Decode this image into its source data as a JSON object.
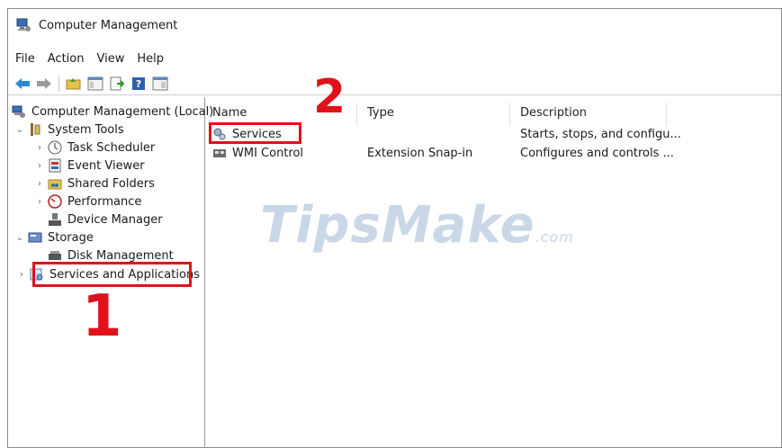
{
  "window": {
    "title": "Computer Management"
  },
  "menu": [
    "File",
    "Action",
    "View",
    "Help"
  ],
  "toolbar": {
    "icons": [
      "back-arrow-icon",
      "forward-arrow-icon",
      "up-folder-icon",
      "console-tree-icon",
      "export-list-icon",
      "help-icon",
      "show-hide-icon"
    ]
  },
  "tree": {
    "root": "Computer Management (Local)",
    "system_tools": "System Tools",
    "task_scheduler": "Task Scheduler",
    "event_viewer": "Event Viewer",
    "shared_folders": "Shared Folders",
    "performance": "Performance",
    "device_manager": "Device Manager",
    "storage": "Storage",
    "disk_management": "Disk Management",
    "services_apps": "Services and Applications"
  },
  "list": {
    "columns": [
      "Name",
      "Type",
      "Description"
    ],
    "rows": [
      {
        "name": "Services",
        "type": "",
        "description": "Starts, stops, and configu..."
      },
      {
        "name": "WMI Control",
        "type": "Extension Snap-in",
        "description": "Configures and controls ..."
      }
    ]
  },
  "annotations": {
    "step1": "1",
    "step2": "2"
  },
  "watermark": {
    "main": "TipsMake",
    "suffix": ".com"
  },
  "colors": {
    "annotation_red": "#e0111b",
    "watermark": "#c9d7e6"
  }
}
